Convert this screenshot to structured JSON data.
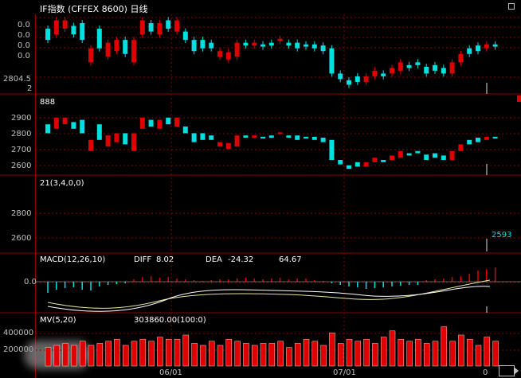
{
  "window": {
    "title": "IF指数 (CFFEX 8600) 日线"
  },
  "price_pane": {
    "ylabels": [
      "0.0",
      "0.0",
      "0.0",
      "0.0",
      "2804.5",
      "2"
    ]
  },
  "secondary_pane": {
    "header": "888",
    "ylabels": [
      "2900",
      "2800",
      "2700",
      "2600"
    ]
  },
  "indicator_pane": {
    "header": "21(3,4,0,0)",
    "ylabels": [
      "2800",
      "2600"
    ],
    "last_value": "2593"
  },
  "macd_pane": {
    "header": "MACD(12,26,10)",
    "diff_label": "DIFF",
    "diff_value": "8.02",
    "dea_label": "DEA",
    "dea_value": "-24.32",
    "macd_value": "64.67",
    "ylabels": [
      "0.0"
    ]
  },
  "volume_pane": {
    "header": "MV(5,20)",
    "value": "303860.00(100:0)",
    "ylabels": [
      "400000",
      "200000"
    ]
  },
  "xaxis": {
    "labels": [
      "06/01",
      "07/01",
      "0"
    ]
  },
  "colors": {
    "up": "#e00000",
    "down": "#00e0e0",
    "grid": "#8b0000",
    "bg": "#000000"
  },
  "candles": [
    [
      "d",
      0.6,
      0.8
    ],
    [
      "u",
      0.7,
      0.95
    ],
    [
      "u",
      0.8,
      0.95
    ],
    [
      "d",
      0.7,
      0.85
    ],
    [
      "d",
      0.6,
      0.9
    ],
    [
      "u",
      0.2,
      0.45
    ],
    [
      "d",
      0.45,
      0.8
    ],
    [
      "u",
      0.3,
      0.55
    ],
    [
      "u",
      0.4,
      0.6
    ],
    [
      "d",
      0.35,
      0.6
    ],
    [
      "u",
      0.2,
      0.6
    ],
    [
      "u",
      0.7,
      0.95
    ],
    [
      "d",
      0.75,
      0.9
    ],
    [
      "u",
      0.7,
      0.9
    ],
    [
      "d",
      0.8,
      0.95
    ],
    [
      "u",
      0.75,
      0.95
    ],
    [
      "d",
      0.6,
      0.75
    ],
    [
      "d",
      0.4,
      0.6
    ],
    [
      "d",
      0.45,
      0.6
    ],
    [
      "d",
      0.45,
      0.55
    ],
    [
      "u",
      0.3,
      0.4
    ],
    [
      "u",
      0.25,
      0.38
    ],
    [
      "u",
      0.3,
      0.55
    ],
    [
      "d",
      0.5,
      0.55
    ],
    [
      "u",
      0.5,
      0.55
    ],
    [
      "d",
      0.48,
      0.52
    ],
    [
      "d",
      0.5,
      0.55
    ],
    [
      "u",
      0.58,
      0.62
    ],
    [
      "d",
      0.5,
      0.55
    ],
    [
      "d",
      0.45,
      0.55
    ],
    [
      "d",
      0.48,
      0.52
    ],
    [
      "d",
      0.45,
      0.52
    ],
    [
      "d",
      0.4,
      0.5
    ],
    [
      "d",
      0.0,
      0.45
    ],
    [
      "d",
      -0.1,
      0.0
    ],
    [
      "d",
      -0.2,
      -0.12
    ],
    [
      "d",
      -0.15,
      -0.05
    ],
    [
      "u",
      -0.15,
      -0.05
    ],
    [
      "u",
      -0.05,
      0.05
    ],
    [
      "d",
      -0.05,
      0.0
    ],
    [
      "u",
      0.0,
      0.1
    ],
    [
      "u",
      0.05,
      0.2
    ],
    [
      "d",
      0.1,
      0.15
    ],
    [
      "d",
      0.15,
      0.2
    ],
    [
      "d",
      0.0,
      0.12
    ],
    [
      "d",
      0.05,
      0.15
    ],
    [
      "d",
      0.0,
      0.1
    ],
    [
      "u",
      0.0,
      0.2
    ],
    [
      "u",
      0.2,
      0.35
    ],
    [
      "d",
      0.35,
      0.45
    ],
    [
      "d",
      0.4,
      0.5
    ],
    [
      "u",
      0.45,
      0.52
    ],
    [
      "d",
      0.48,
      0.52
    ]
  ],
  "macd_bars": [
    -0.7,
    -0.5,
    -0.4,
    -0.35,
    -0.5,
    -0.55,
    -0.3,
    -0.2,
    -0.15,
    -0.1,
    0.15,
    0.3,
    0.35,
    0.25,
    0.3,
    0.2,
    0.15,
    0.1,
    0.05,
    0.1,
    0.15,
    0.15,
    0.2,
    0.25,
    0.2,
    0.15,
    0.2,
    0.25,
    0.15,
    0.2,
    0.2,
    0.1,
    0.05,
    -0.1,
    -0.2,
    -0.3,
    -0.35,
    -0.45,
    -0.4,
    -0.35,
    -0.3,
    -0.25,
    -0.2,
    -0.2,
    0.1,
    0.15,
    0.2,
    0.3,
    0.35,
    0.5,
    0.7,
    0.8,
    0.9
  ],
  "volume_bars": [
    0.45,
    0.5,
    0.55,
    0.5,
    0.6,
    0.5,
    0.55,
    0.6,
    0.65,
    0.5,
    0.6,
    0.65,
    0.6,
    0.7,
    0.65,
    0.65,
    0.75,
    0.55,
    0.5,
    0.6,
    0.5,
    0.65,
    0.6,
    0.55,
    0.5,
    0.55,
    0.55,
    0.6,
    0.45,
    0.55,
    0.65,
    0.6,
    0.5,
    0.8,
    0.55,
    0.65,
    0.6,
    0.65,
    0.55,
    0.7,
    0.85,
    0.65,
    0.6,
    0.65,
    0.55,
    0.6,
    0.95,
    0.6,
    0.75,
    0.65,
    0.5,
    0.7,
    0.6
  ]
}
